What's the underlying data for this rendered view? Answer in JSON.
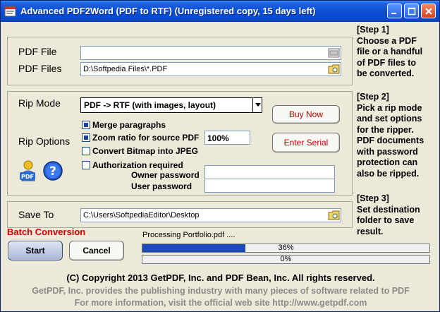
{
  "window": {
    "title": "Advanced PDF2Word (PDF to RTF) (Unregistered copy, 15 days left)"
  },
  "step1": {
    "pdf_file_label": "PDF File",
    "pdf_file_value": "",
    "pdf_files_label": "PDF Files",
    "pdf_files_value": "D:\\Softpedia Files\\*.PDF",
    "text_lines": [
      "[Step 1]",
      "Choose a PDF",
      "file or a handful",
      "of PDF files to",
      "be converted."
    ]
  },
  "step2": {
    "rip_mode_label": "Rip Mode",
    "rip_mode_value": "PDF -> RTF  (with images, layout)",
    "rip_options_label": "Rip Options",
    "options": [
      {
        "label": "Merge paragraphs",
        "checked": true
      },
      {
        "label": "Zoom ratio for source PDF",
        "checked": true
      },
      {
        "label": "Convert Bitmap into JPEG",
        "checked": false
      },
      {
        "label": "Authorization required",
        "checked": false
      }
    ],
    "zoom_value": "100%",
    "owner_password_label": "Owner password",
    "user_password_label": "User password",
    "owner_password_value": "",
    "user_password_value": "",
    "buy_now_label": "Buy Now",
    "enter_serial_label": "Enter Serial",
    "text_lines": [
      "[Step 2]",
      "Pick a rip mode",
      "and set options",
      "for the ripper.",
      "PDF documents",
      "with password",
      "protection can",
      "also be ripped."
    ]
  },
  "step3": {
    "save_to_label": "Save To",
    "save_to_value": "C:\\Users\\SoftpediaEditor\\Desktop",
    "text_lines": [
      "[Step 3]",
      "Set destination",
      "folder to save",
      "result."
    ]
  },
  "batch": {
    "label": "Batch Conversion",
    "start_label": "Start",
    "cancel_label": "Cancel",
    "processing_text": "Processing Portfolio.pdf ....",
    "progress1_text": "36%",
    "progress1_value": 36,
    "progress2_text": "0%",
    "progress2_value": 0
  },
  "footer": {
    "copyright": "(C) Copyright 2013 GetPDF, Inc. and PDF Bean, Inc.  All rights reserved.",
    "info_line1": "GetPDF, Inc. provides the publishing industry with many pieces of software related to PDF",
    "info_line2": "For more information, visit the official web site http://www.getpdf.com"
  },
  "colors": {
    "title_bar": "#0a48c8",
    "batch_label": "#d40000",
    "progress_fill": "#1c48b8",
    "info_text": "#8a8a8a"
  },
  "icons": [
    "app-icon",
    "minimize-icon",
    "maximize-icon",
    "close-icon",
    "folder-browse-icon",
    "dropdown-arrow-icon",
    "pdf-person-icon",
    "help-icon"
  ]
}
